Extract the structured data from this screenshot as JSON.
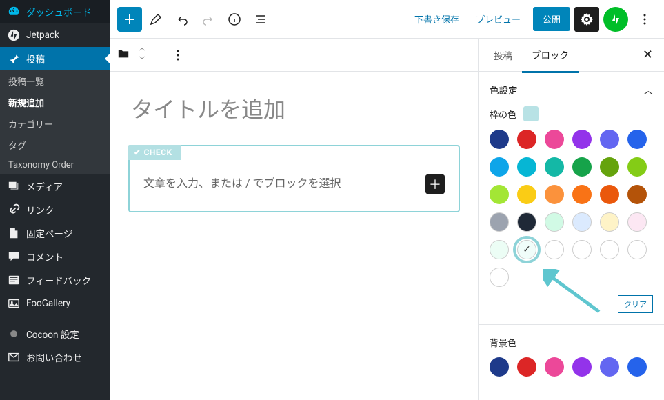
{
  "sidebar": {
    "dashboard": "ダッシュボード",
    "jetpack": "Jetpack",
    "posts": "投稿",
    "posts_sub": {
      "list": "投稿一覧",
      "new": "新規追加",
      "categories": "カテゴリー",
      "tags": "タグ",
      "taxonomy": "Taxonomy Order"
    },
    "media": "メディア",
    "links": "リンク",
    "pages": "固定ページ",
    "comments": "コメント",
    "feedback": "フィードバック",
    "foogallery": "FooGallery",
    "cocoon": "Cocoon 設定",
    "contact": "お問い合わせ"
  },
  "toolbar": {
    "save_draft": "下書き保存",
    "preview": "プレビュー",
    "publish": "公開"
  },
  "editor": {
    "title_placeholder": "タイトルを追加",
    "check_label": "CHECK",
    "block_placeholder": "文章を入力、または / でブロックを選択"
  },
  "panel": {
    "tab_post": "投稿",
    "tab_block": "ブロック",
    "color_section": "色設定",
    "border_color_label": "枠の色",
    "selected_border_color": "#b8e2e5",
    "clear_label": "クリア",
    "bg_color_label": "背景色",
    "swatches_row1": [
      "#1e3a8a",
      "#dc2626",
      "#ec4899",
      "#9333ea",
      "#6366f1",
      "#2563eb"
    ],
    "swatches_row2": [
      "#0ea5e9",
      "#06b6d4",
      "#14b8a6",
      "#16a34a",
      "#65a30d",
      "#84cc16"
    ],
    "swatches_row3": [
      "#a3e635",
      "#facc15",
      "#fb923c",
      "#f97316",
      "#ea580c",
      "#b45309"
    ],
    "swatches_row4": [
      "#9ca3af",
      "#1f2937",
      "#d1fae5",
      "#dbeafe",
      "#fef3c7",
      "#fce7f3"
    ],
    "swatches_row5": [
      "#ecfdf5",
      "#f0fdfa",
      "#ffffff",
      "#ffffff",
      "#ffffff",
      "#ffffff"
    ],
    "swatches_row6": [
      "#ffffff"
    ],
    "bg_swatches": [
      "#1e3a8a",
      "#dc2626",
      "#ec4899",
      "#9333ea",
      "#6366f1",
      "#2563eb"
    ]
  }
}
